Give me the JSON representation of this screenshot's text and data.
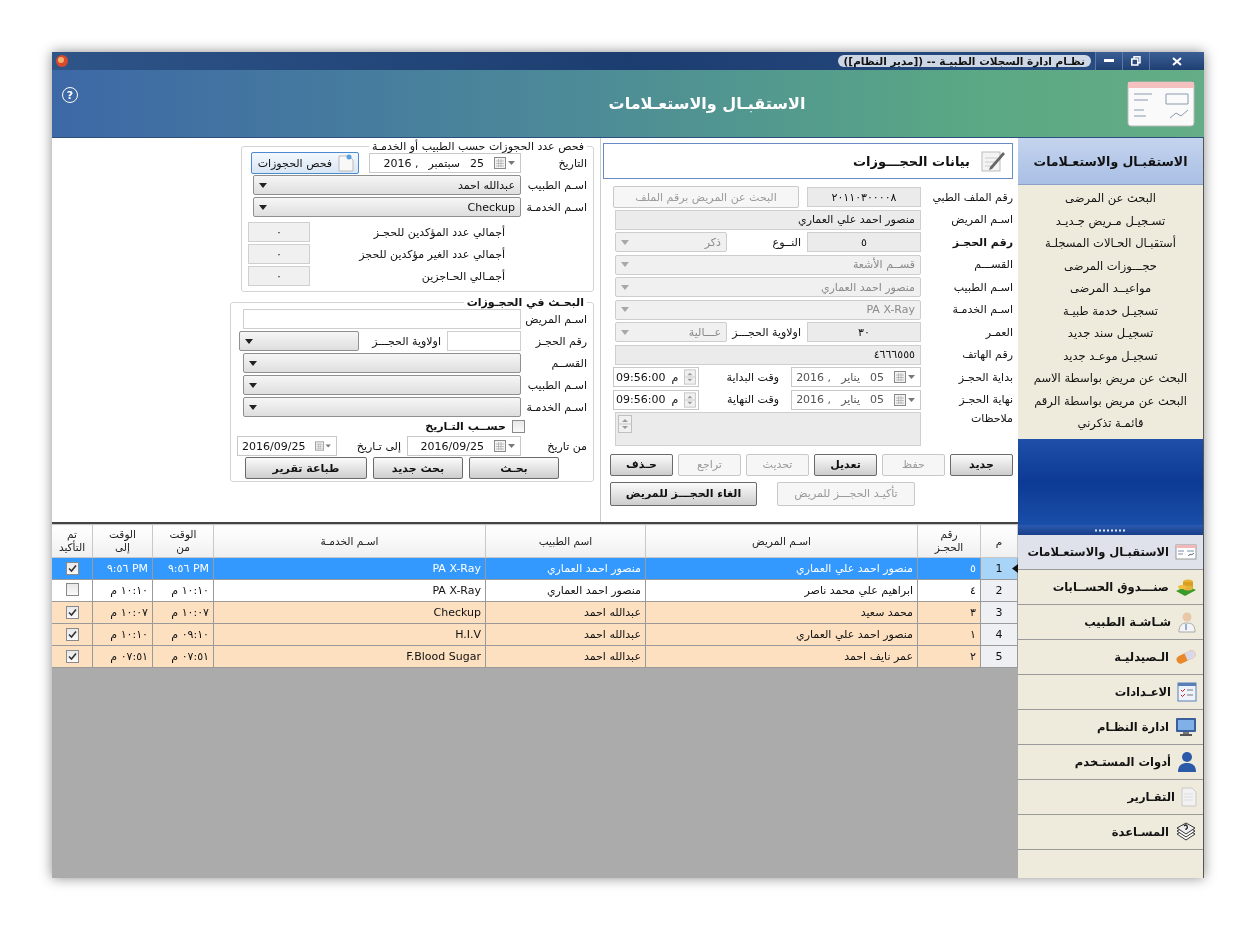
{
  "window": {
    "title": "نظـام ادارة السجلات الطبيـة -- ([مدير النظام])"
  },
  "header": {
    "help": "?",
    "title": "الاستقبـال والاستعـلامات"
  },
  "check_panel": {
    "title": "فحص عدد الحجوزات حسب الطبيب أو الخدمـة",
    "date_label": "التاريخ",
    "date": {
      "day": "25",
      "month": "سبتمبر",
      "year": "2016 ,"
    },
    "check_button": "فحص الحجوزات",
    "fields": [
      {
        "label": "اسـم الطبيب",
        "value": "عبدالله احمد"
      },
      {
        "label": "اسـم الخدمـة",
        "value": "Checkup"
      }
    ],
    "totals": [
      {
        "label": "أجمالي عدد المؤكدين للحجـز",
        "value": "٠"
      },
      {
        "label": "أجمالي عدد الغير مؤكدين للحجز",
        "value": "٠"
      },
      {
        "label": "أجمـالي الحـاجزين",
        "value": "٠"
      }
    ]
  },
  "search_panel": {
    "title": "البحـث في الحجـوزات",
    "patient_label": "اسـم المريض",
    "booking_label": "رقم الحجـز",
    "priority_label": "اولاوية الحجـــز",
    "dropdowns": [
      {
        "label": "القســم"
      },
      {
        "label": "اسـم الطبيب"
      },
      {
        "label": "اسـم الخدمـة"
      }
    ],
    "by_date": {
      "label": "حســب التـاريخ",
      "checked": false
    },
    "from_label": "من تاريخ",
    "from": "2016/09/25",
    "to_label": "إلى تـاريخ",
    "to": "2016/09/25",
    "buttons": [
      "بحـث",
      "بحث جديد",
      "طباعة تقرير"
    ]
  },
  "booking_form": {
    "title": "بيانات الحجـــوزات",
    "rows": [
      {
        "kind": "file",
        "label": "رقم الملف الطبي",
        "bold": false,
        "value": "٢٠١١٠٣٠٠٠٠٨",
        "button": "البحث عن المريض برقم الملف"
      },
      {
        "kind": "text",
        "label": "اسـم المريض",
        "bold": false,
        "value": "منصور احمد علي العماري"
      },
      {
        "kind": "pair",
        "label": "رقم الحجـز",
        "bold": true,
        "value": "٥",
        "label2": "النــوع",
        "value2": "ذكر"
      },
      {
        "kind": "select",
        "label": "القســـم",
        "bold": false,
        "value": "قســم الأشعة"
      },
      {
        "kind": "select",
        "label": "اسـم الطبيب",
        "bold": false,
        "value": "منصور احمد العماري"
      },
      {
        "kind": "select",
        "label": "اسـم الخدمـة",
        "bold": false,
        "value": "PA X-Ray"
      },
      {
        "kind": "pair",
        "label": "العمـر",
        "bold": false,
        "value": "٣٠",
        "label2": "اولاوية الحجـــز",
        "value2": "عـــالية"
      },
      {
        "kind": "text",
        "label": "رقم الهاتف",
        "bold": false,
        "value": "٤٦٦٦٥٥٥"
      },
      {
        "kind": "datetime",
        "label": "بداية الحجـز",
        "bold": false,
        "day": "05",
        "month": "يناير",
        "year": "2016 ,",
        "time_label": "وقت البداية",
        "ampm": "م",
        "time": "09:56:00"
      },
      {
        "kind": "datetime",
        "label": "نهاية الحجـز",
        "bold": false,
        "day": "05",
        "month": "يناير",
        "year": "2016 ,",
        "time_label": "وقت النهاية",
        "ampm": "م",
        "time": "09:56:00"
      },
      {
        "kind": "notes",
        "label": "ملاحظات",
        "bold": false
      }
    ],
    "buttons": [
      {
        "label": "جديد",
        "disabled": false
      },
      {
        "label": "حفظ",
        "disabled": true
      },
      {
        "label": "تعديل",
        "disabled": false
      },
      {
        "label": "تحديث",
        "disabled": true
      },
      {
        "label": "تراجع",
        "disabled": true
      },
      {
        "label": "حـذف",
        "disabled": false
      }
    ],
    "actions": [
      {
        "label": "تأكيـد الحجـــز للمريض",
        "disabled": true
      },
      {
        "label": "الغاء الحجـــز للمريض",
        "disabled": false
      }
    ]
  },
  "bookings_table": {
    "columns": [
      "م",
      "رقم\nالحجـز",
      "اسـم المريض",
      "اسم الطبيب",
      "اسـم الخدمـة",
      "الوقت\nمن",
      "الوقت\nإلى",
      "تم\nالتأكيد"
    ],
    "rows": [
      {
        "index": "1",
        "selected": true,
        "number": "٥",
        "patient": "منصور احمد علي العماري",
        "doctor": "منصور احمد العماري",
        "service": "PA X-Ray",
        "time_from": "PM ٩:٥٦",
        "time_to": "PM ٩:٥٦",
        "confirmed": true
      },
      {
        "index": "2",
        "selected": false,
        "number": "٤",
        "patient": "ابراهيم علي محمد ناصر",
        "doctor": "منصور احمد العماري",
        "service": "PA X-Ray",
        "time_from": "١٠:١٠ م",
        "time_to": "١٠:١٠ م",
        "confirmed": false
      },
      {
        "index": "3",
        "selected": false,
        "number": "٣",
        "patient": "محمد سعيد",
        "doctor": "عبدالله احمد",
        "service": "Checkup",
        "time_from": "١٠:٠٧ م",
        "time_to": "١٠:٠٧ م",
        "confirmed": true
      },
      {
        "index": "4",
        "selected": false,
        "number": "١",
        "patient": "منصور احمد علي العماري",
        "doctor": "عبدالله احمد",
        "service": "H.I.V",
        "time_from": "٠٩:١٠ م",
        "time_to": "١٠:١٠ م",
        "confirmed": true
      },
      {
        "index": "5",
        "selected": false,
        "number": "٢",
        "patient": "عمر نايف احمد",
        "doctor": "عبدالله احمد",
        "service": "F.Blood Sugar",
        "time_from": "٠٧:٥١ م",
        "time_to": "٠٧:٥١ م",
        "confirmed": true
      }
    ]
  },
  "sidebar": {
    "title": "الاستقبـال والاستعـلامات",
    "items": [
      "البحث عن المرضى",
      "تسـجيـل مـريض جـديـد",
      "أستقبـال الحـالات المسجلـة",
      "حجـــوزات المرضى",
      "مواعيــد المرضى",
      "تسجيـل خدمة طبيـة",
      "تسجيـل سند جديد",
      "تسجيـل موعـد جديد",
      "البحث عن مريض بواسطة الاسم",
      "البحث عن مريض بواسطة الرقم",
      "قائمـة تذكرني"
    ],
    "nav": [
      {
        "label": "الاستقبـال والاستعـلامات",
        "selected": true
      },
      {
        "label": "صنـــدوق الحســابات",
        "selected": false
      },
      {
        "label": "شـاشـة الطبيب",
        "selected": false
      },
      {
        "label": "الـصيدليـة",
        "selected": false
      },
      {
        "label": "الاعـدادات",
        "selected": false
      },
      {
        "label": "ادارة النظـام",
        "selected": false
      },
      {
        "label": "أدوات المستـخدم",
        "selected": false
      },
      {
        "label": "التقـارير",
        "selected": false
      },
      {
        "label": "المسـاعدة",
        "selected": false
      }
    ]
  }
}
